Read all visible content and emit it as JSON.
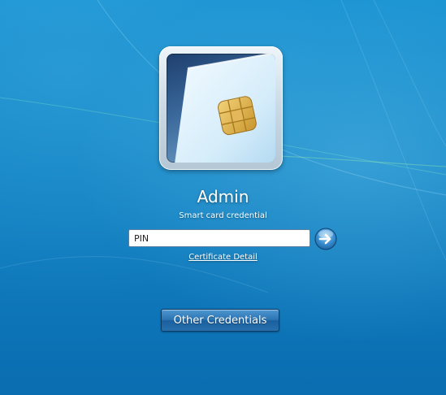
{
  "user": {
    "name": "Admin",
    "credential_type": "Smart card credential"
  },
  "pin_field": {
    "placeholder": "PIN",
    "value": ""
  },
  "submit_button": {
    "icon": "arrow-right-icon"
  },
  "links": {
    "certificate_detail": "Certificate Detail"
  },
  "buttons": {
    "other_credentials": "Other Credentials"
  },
  "tile": {
    "icon": "smart-card-icon"
  },
  "colors": {
    "background": "#1689c9",
    "chip": "#e0b347",
    "text": "#ffffff"
  }
}
